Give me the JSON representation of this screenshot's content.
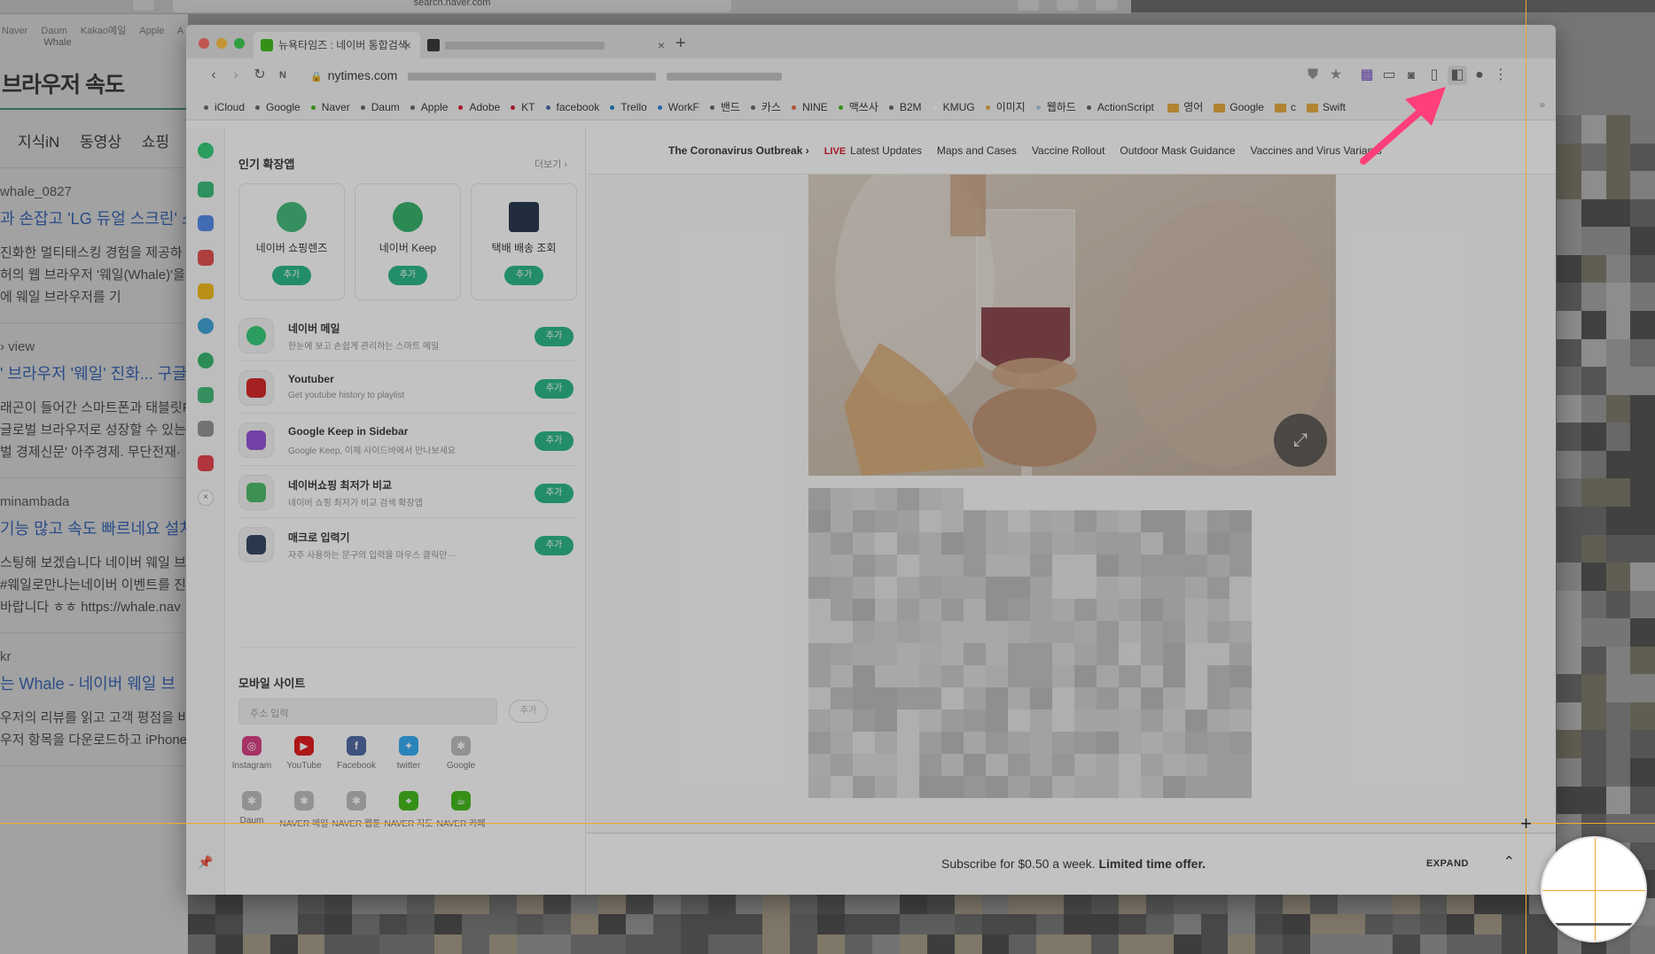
{
  "background": {
    "address": "search.naver.com",
    "bookmarks": "Naver  Daum  Kakao예일  Apple  A",
    "tab_name": "Whale",
    "title": "브라우저 속도",
    "tabs": "지식iN  동영상  쇼핑",
    "results": [
      {
        "src": "whale_0827",
        "head": "과 손잡고 'LG 듀얼 스크린' 스",
        "snip": [
          "진화한 멀티태스킹 경험을 제공하",
          "허의 웹 브라우저 '웨일(Whale)'을",
          "에 웨일 브라우저를 기"
        ]
      },
      {
        "src": "› view",
        "head": "' 브라우저 '웨일' 진화... 구글",
        "snip": [
          "래곤이 들어간 스마트폰과 태블릿P",
          "글로벌 브라우저로 성장할 수 있는",
          "벌 경제신문' 아주경제. 무단전재·"
        ]
      },
      {
        "src": "minambada",
        "head": "기능 많고 속도 빠르네요 설치",
        "snip": [
          "스팅해 보겠습니다 네이버 웨일 브",
          "#웨일로만나는네이버 이벤트를 진",
          "바랍니다 ㅎㅎ https://whale.nav"
        ]
      },
      {
        "src": "kr",
        "head": "는 Whale - 네이버 웨일 브",
        "snip": [
          "우저의 리뷰를 읽고 고객 평점을 비",
          "우저 항목을 다운로드하고 iPhone"
        ]
      }
    ]
  },
  "window": {
    "tabs": [
      {
        "title": "뉴욕타임즈 : 네이버 통합검색",
        "close": "×"
      },
      {
        "title": "",
        "close": "×"
      }
    ],
    "new_tab": "+",
    "url": "nytimes.com",
    "bookmarks": [
      {
        "label": "iCloud",
        "color": "#555555"
      },
      {
        "label": "Google",
        "color": "#555555"
      },
      {
        "label": "Naver",
        "color": "#2db400"
      },
      {
        "label": "Daum",
        "color": "#555555"
      },
      {
        "label": "Apple",
        "color": "#555555"
      },
      {
        "label": "Adobe",
        "color": "#d0021b"
      },
      {
        "label": "KT",
        "color": "#d0021b"
      },
      {
        "label": "facebook",
        "color": "#3b5998"
      },
      {
        "label": "Trello",
        "color": "#0079bf"
      },
      {
        "label": "WorkF",
        "color": "#1a73e8"
      },
      {
        "label": "밴드",
        "color": "#555555"
      },
      {
        "label": "카스",
        "color": "#555555"
      },
      {
        "label": "NINE",
        "color": "#e5572b"
      },
      {
        "label": "맥쓰사",
        "color": "#2db400"
      },
      {
        "label": "B2M",
        "color": "#555555"
      },
      {
        "label": "KMUG",
        "color": "#ffffff"
      },
      {
        "label": "이미지",
        "color": "#e5a32b"
      },
      {
        "label": "웹하드",
        "color": "#a6c8e8"
      },
      {
        "label": "ActionScript",
        "color": "#555555"
      }
    ],
    "bookmark_folders": [
      "영어",
      "Google",
      "c",
      "Swift"
    ],
    "bookmark_overflow": "»"
  },
  "panel": {
    "title": "인기 확장앱",
    "more": "더보기 ›",
    "cards": [
      {
        "name": "네이버 쇼핑렌즈",
        "add": "추가",
        "icon_color": "#2fb36b"
      },
      {
        "name": "네이버 Keep",
        "add": "추가",
        "icon_color": "#1eab5b"
      },
      {
        "name": "택배 배송 조회",
        "add": "추가",
        "icon_color": "#10223a"
      }
    ],
    "rows": [
      {
        "name": "네이버 메일",
        "desc": "한눈에 보고 손쉽게 관리하는 스마트 메일",
        "add": "추가",
        "icon_color": "#1ec86a"
      },
      {
        "name": "Youtuber",
        "desc": "Get youtube history to playlist",
        "add": "추가",
        "icon_color": "#d20f0f"
      },
      {
        "name": "Google Keep in Sidebar",
        "desc": "Google Keep, 이제 사이드바에서 만나보세요",
        "add": "추가",
        "icon_color": "#8b3fd6"
      },
      {
        "name": "네이버쇼핑 최저가 비교",
        "desc": "네이버 쇼핑 최저가 비교 검색 확장앱",
        "add": "추가",
        "icon_color": "#3ab55b"
      },
      {
        "name": "매크로 입력기",
        "desc": "자주 사용하는 문구의 입력을 마우스 클릭만···",
        "add": "추가",
        "icon_color": "#1f3250"
      }
    ],
    "mobile_title": "모바일 사이트",
    "url_placeholder": "주소 입력",
    "url_add": "추가",
    "sites": [
      {
        "name": "Instagram",
        "color": "#d62976",
        "glyph": "◎"
      },
      {
        "name": "YouTube",
        "color": "#e00000",
        "glyph": "▶"
      },
      {
        "name": "Facebook",
        "color": "#3b5998",
        "glyph": "f"
      },
      {
        "name": "twitter",
        "color": "#1da1f2",
        "glyph": "✦"
      },
      {
        "name": "Google",
        "color": "#b8b8b8",
        "glyph": "✱"
      },
      {
        "name": "Daum",
        "color": "#b8b8b8",
        "glyph": "✱"
      },
      {
        "name": "NAVER 메일",
        "color": "#b8b8b8",
        "glyph": "✱"
      },
      {
        "name": "NAVER 웹툰",
        "color": "#b8b8b8",
        "glyph": "✱"
      },
      {
        "name": "NAVER 지도",
        "color": "#2db400",
        "glyph": "⌖"
      },
      {
        "name": "NAVER 카페",
        "color": "#2db400",
        "glyph": "☕"
      }
    ]
  },
  "content": {
    "nav": [
      {
        "label": "The Coronavirus Outbreak ›",
        "bold": true
      },
      {
        "label": "Latest Updates",
        "live": "LIVE"
      },
      {
        "label": "Maps and Cases"
      },
      {
        "label": "Vaccine Rollout"
      },
      {
        "label": "Outdoor Mask Guidance"
      },
      {
        "label": "Vaccines and Virus Variants"
      }
    ],
    "expand_icon": "⤢",
    "subscribe": {
      "text": "Subscribe for $0.50 a week.",
      "offer": "Limited time offer.",
      "expand": "EXPAND",
      "chevron": "⌃"
    }
  },
  "colors": {
    "accent_green": "#13b17b",
    "arrow": "#ff3f7a",
    "guide": "#f0a830"
  }
}
